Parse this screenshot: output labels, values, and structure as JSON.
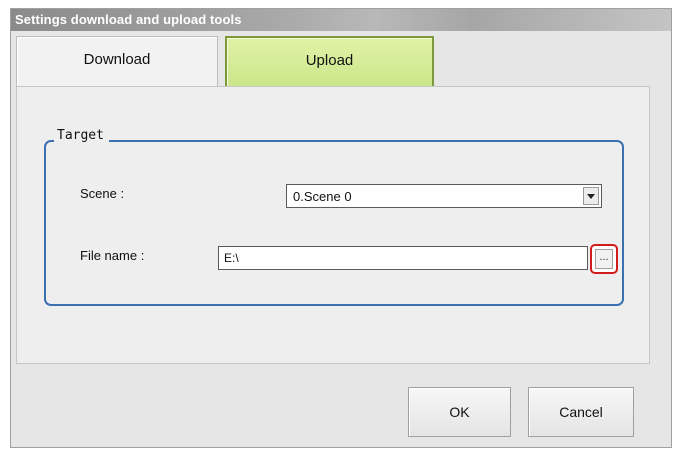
{
  "window": {
    "title": "Settings download and upload tools"
  },
  "tabs": [
    {
      "label": "Download",
      "active": false
    },
    {
      "label": "Upload",
      "active": true
    }
  ],
  "target_group": {
    "legend": "Target",
    "scene_label": "Scene :",
    "scene_value": "0.Scene 0",
    "file_label": "File name :",
    "file_value": "E:\\",
    "browse_label": "..."
  },
  "buttons": {
    "ok": "OK",
    "cancel": "Cancel"
  },
  "colors": {
    "active_tab": "#cce68a",
    "group_border": "#3a6fb0",
    "highlight": "#d21c1c"
  }
}
